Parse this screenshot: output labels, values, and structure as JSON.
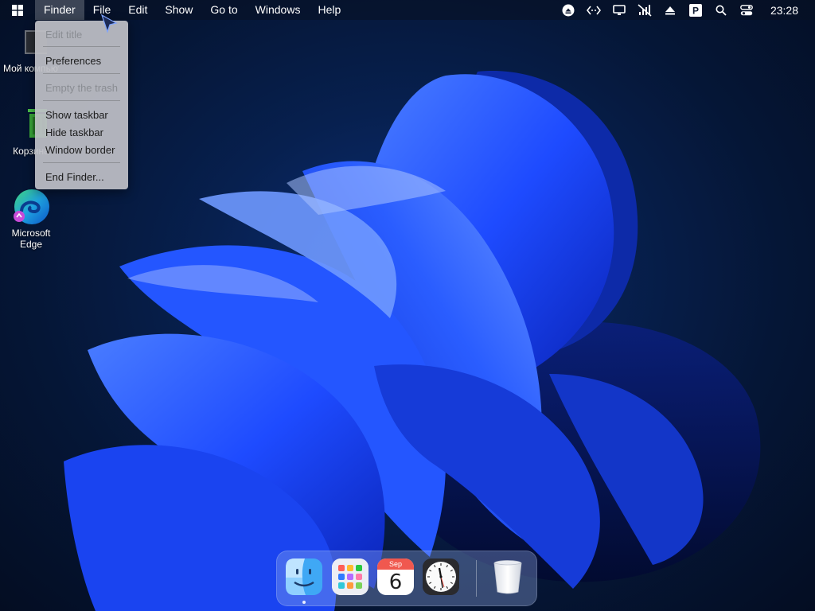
{
  "menubar": {
    "menus": [
      "Finder",
      "File",
      "Edit",
      "Show",
      "Go to",
      "Windows",
      "Help"
    ],
    "active_menu": "Finder",
    "clock": "23:28"
  },
  "dropdown": {
    "items": [
      {
        "label": "Edit title",
        "enabled": false
      },
      {
        "label": "Preferences",
        "enabled": true
      },
      {
        "label": "Empty the trash",
        "enabled": false
      },
      {
        "label": "Show taskbar",
        "enabled": true
      },
      {
        "label": "Hide taskbar",
        "enabled": true
      },
      {
        "label": "Window border",
        "enabled": true
      },
      {
        "label": "End Finder...",
        "enabled": true
      }
    ]
  },
  "desktop_icons": [
    {
      "label": "Мой компьютер",
      "icon": "computer-icon"
    },
    {
      "label": "Корзина",
      "icon": "recycle-bin-icon"
    },
    {
      "label_line1": "Microsoft",
      "label_line2": "Edge",
      "icon": "edge-icon"
    }
  ],
  "dock": {
    "calendar_month": "Sep",
    "calendar_day": "6",
    "apps": [
      "finder-icon",
      "launchpad-icon",
      "calendar-icon",
      "clock-icon",
      "trash-icon"
    ]
  },
  "colors": {
    "accent": "#1f5cff",
    "calendar_red": "#f0584f",
    "wallpaper_dark": "#051636"
  }
}
